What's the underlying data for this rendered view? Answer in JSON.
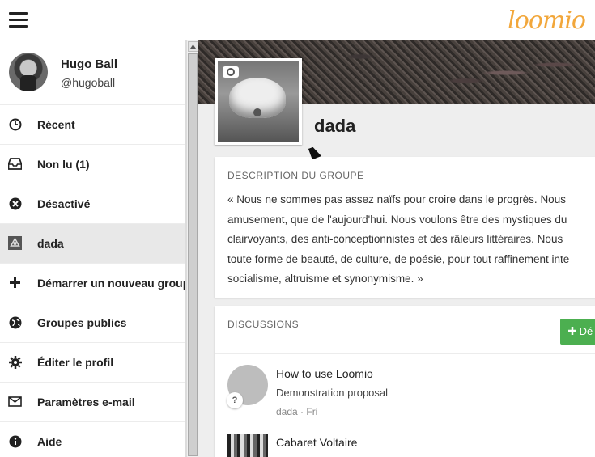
{
  "app": {
    "logo_text": "loomio"
  },
  "user": {
    "name": "Hugo Ball",
    "handle": "@hugoball"
  },
  "sidebar": {
    "items": [
      {
        "label": "Récent",
        "icon": "clock-icon"
      },
      {
        "label": "Non lu (1)",
        "icon": "inbox-icon"
      },
      {
        "label": "Désactivé",
        "icon": "muted-icon"
      },
      {
        "label": "dada",
        "icon": "group-icon",
        "active": true
      },
      {
        "label": "Démarrer un nouveau groupe",
        "icon": "plus-icon"
      },
      {
        "label": "Groupes publics",
        "icon": "globe-icon"
      },
      {
        "label": "Éditer le profil",
        "icon": "gear-icon"
      },
      {
        "label": "Paramètres e-mail",
        "icon": "envelope-icon"
      },
      {
        "label": "Aide",
        "icon": "info-icon"
      }
    ]
  },
  "group": {
    "name": "dada",
    "description_title": "DESCRIPTION DU GROUPE",
    "description_lines": [
      "« Nous ne sommes pas assez naïfs pour croire dans le progrès. Nous",
      "amusement, que de l'aujourd'hui. Nous voulons être des mystiques du",
      "clairvoyants, des anti-conceptionnistes et des râleurs littéraires. Nous",
      "toute forme de beauté, de culture, de poésie, pour tout raffinement inte",
      "socialisme, altruisme et synonymisme. »"
    ]
  },
  "discussions": {
    "title": "DISCUSSIONS",
    "new_button_label": "Dé",
    "items": [
      {
        "title": "How to use Loomio",
        "subtitle": "Demonstration proposal",
        "meta": "dada · Fri"
      },
      {
        "title": "Cabaret Voltaire",
        "subtitle": "",
        "meta": ""
      }
    ]
  },
  "colors": {
    "accent": "#f2a73b",
    "button_green": "#4caf50",
    "active_bg": "#e8e8e8"
  }
}
